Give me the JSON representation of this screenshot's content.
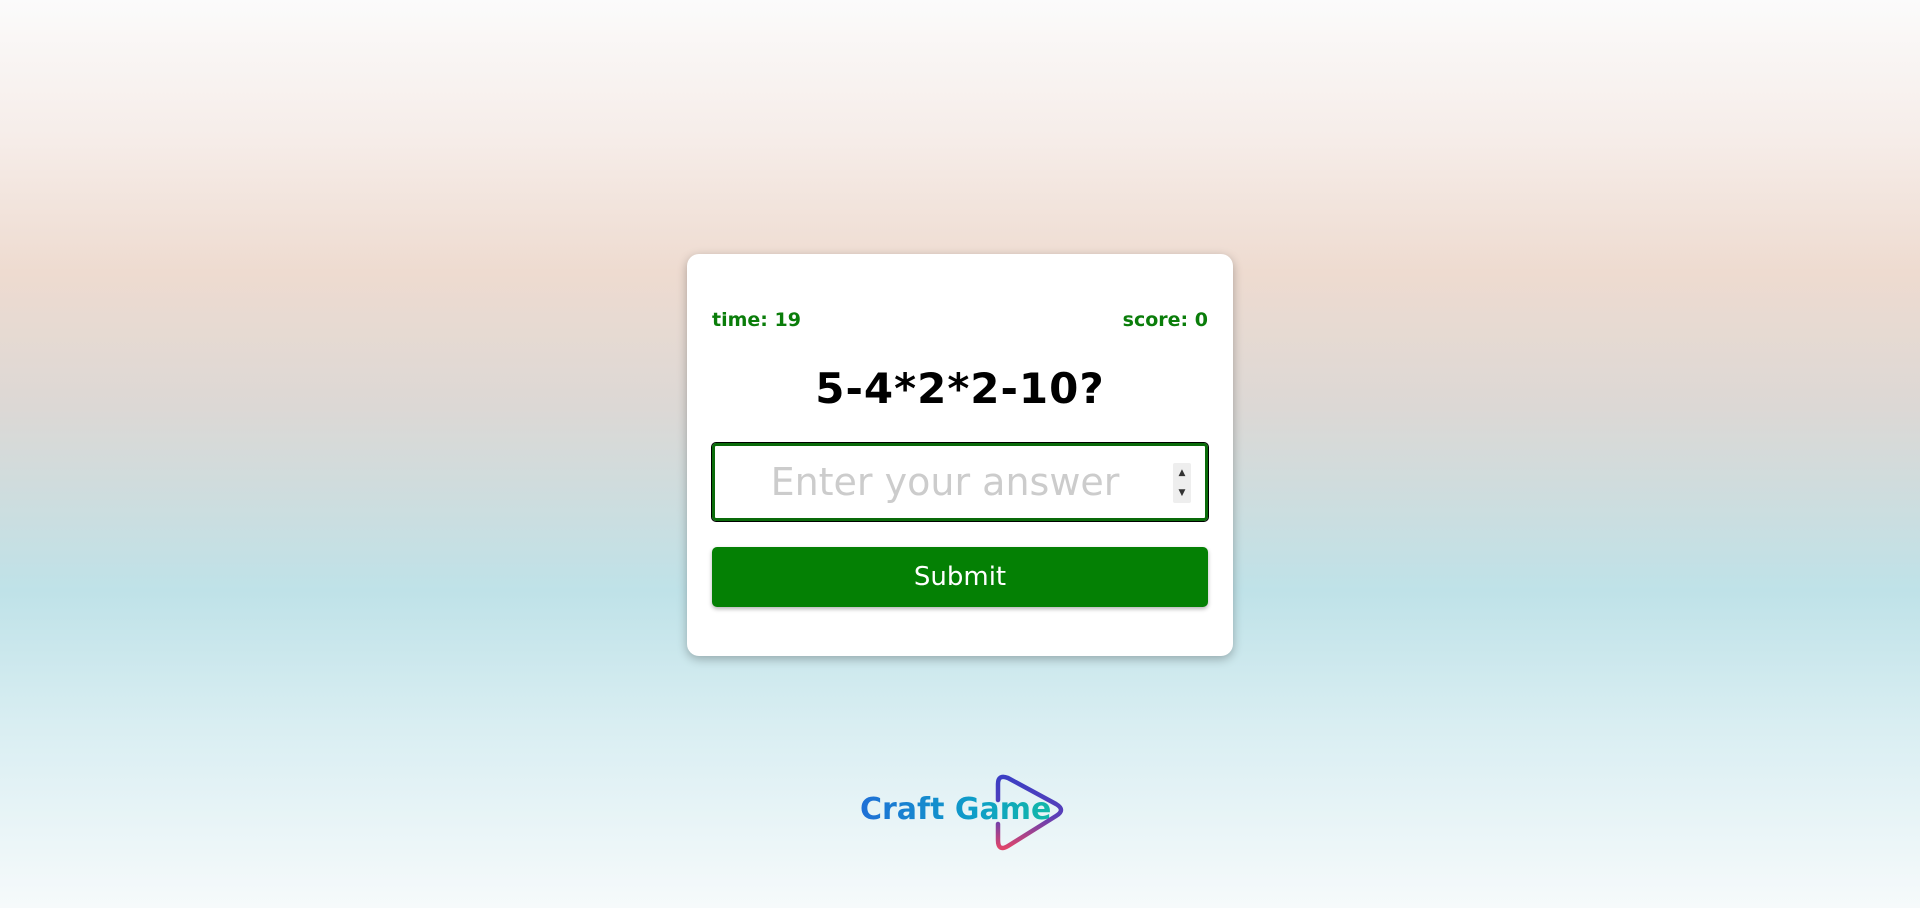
{
  "game": {
    "time_label": "time: 19",
    "score_label": "score: 0",
    "question": "5-4*2*2-10?",
    "answer": {
      "value": "",
      "placeholder": "Enter your answer"
    },
    "submit_label": "Submit"
  },
  "brand": {
    "name": "Craft Game"
  },
  "icons": {
    "spin_up": "triangle-up",
    "spin_down": "triangle-down",
    "logo_mark": "play-triangle-outline"
  },
  "colors": {
    "accent_green": "#048004",
    "stat_green": "#0a7d0a",
    "placeholder_gray": "#cccccc"
  }
}
